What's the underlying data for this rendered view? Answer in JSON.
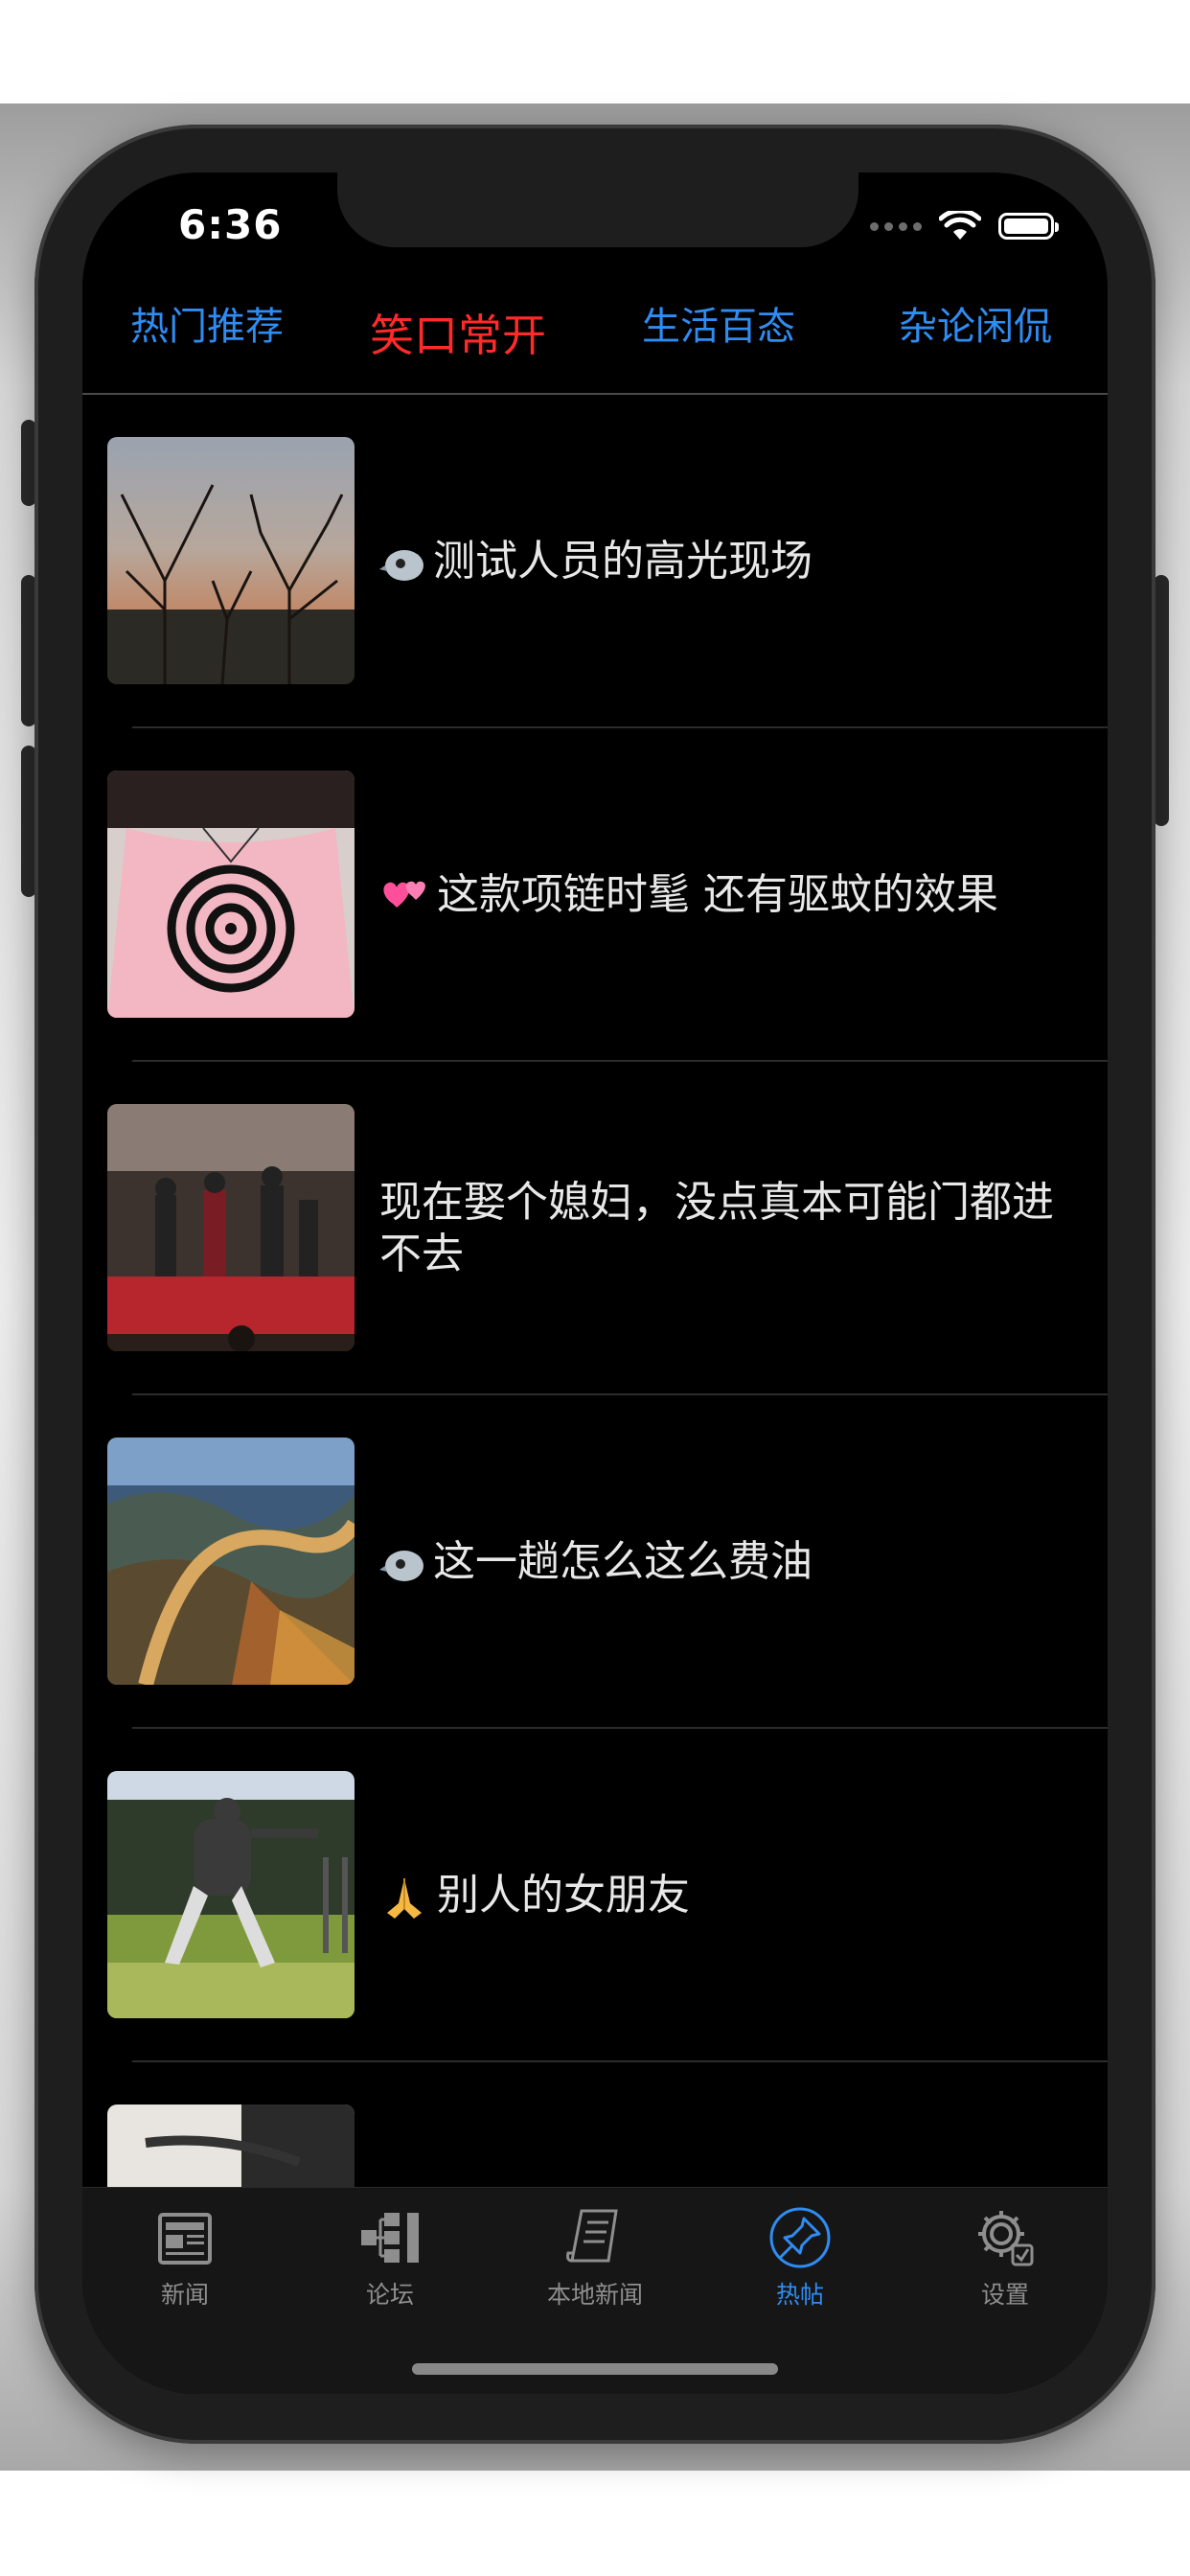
{
  "status_bar": {
    "time": "6:36"
  },
  "top_tabs": [
    {
      "label": "热门推荐",
      "active": false
    },
    {
      "label": "笑口常开",
      "active": true
    },
    {
      "label": "生活百态",
      "active": false
    },
    {
      "label": "杂论闲侃",
      "active": false
    }
  ],
  "posts": [
    {
      "icon": "bird-emoji",
      "title": "测试人员的高光现场",
      "thumb": "cliff-trees"
    },
    {
      "icon": "two-hearts-emoji",
      "title": "这款项链时髦 还有驱蚊的效果",
      "thumb": "mosquito-coil-necklace"
    },
    {
      "icon": "",
      "title": "现在娶个媳妇，没点真本可能门都进不去",
      "thumb": "stage-performance"
    },
    {
      "icon": "bird-emoji",
      "title": "这一趟怎么这么费油",
      "thumb": "winding-river-mountains"
    },
    {
      "icon": "praying-hands-emoji",
      "title": "别人的女朋友",
      "thumb": "person-on-grass"
    },
    {
      "icon": "",
      "title": "",
      "thumb": "partial"
    }
  ],
  "bottom_tabs": [
    {
      "label": "新闻",
      "icon": "newspaper-icon",
      "active": false
    },
    {
      "label": "论坛",
      "icon": "network-tree-icon",
      "active": false
    },
    {
      "label": "本地新闻",
      "icon": "scroll-document-icon",
      "active": false
    },
    {
      "label": "热帖",
      "icon": "pin-icon",
      "active": true
    },
    {
      "label": "设置",
      "icon": "gear-icon",
      "active": false
    }
  ],
  "colors": {
    "accent_blue": "#2f8cf2",
    "active_red": "#ff2a2a",
    "background": "#000000",
    "text": "#e8e8e8"
  }
}
